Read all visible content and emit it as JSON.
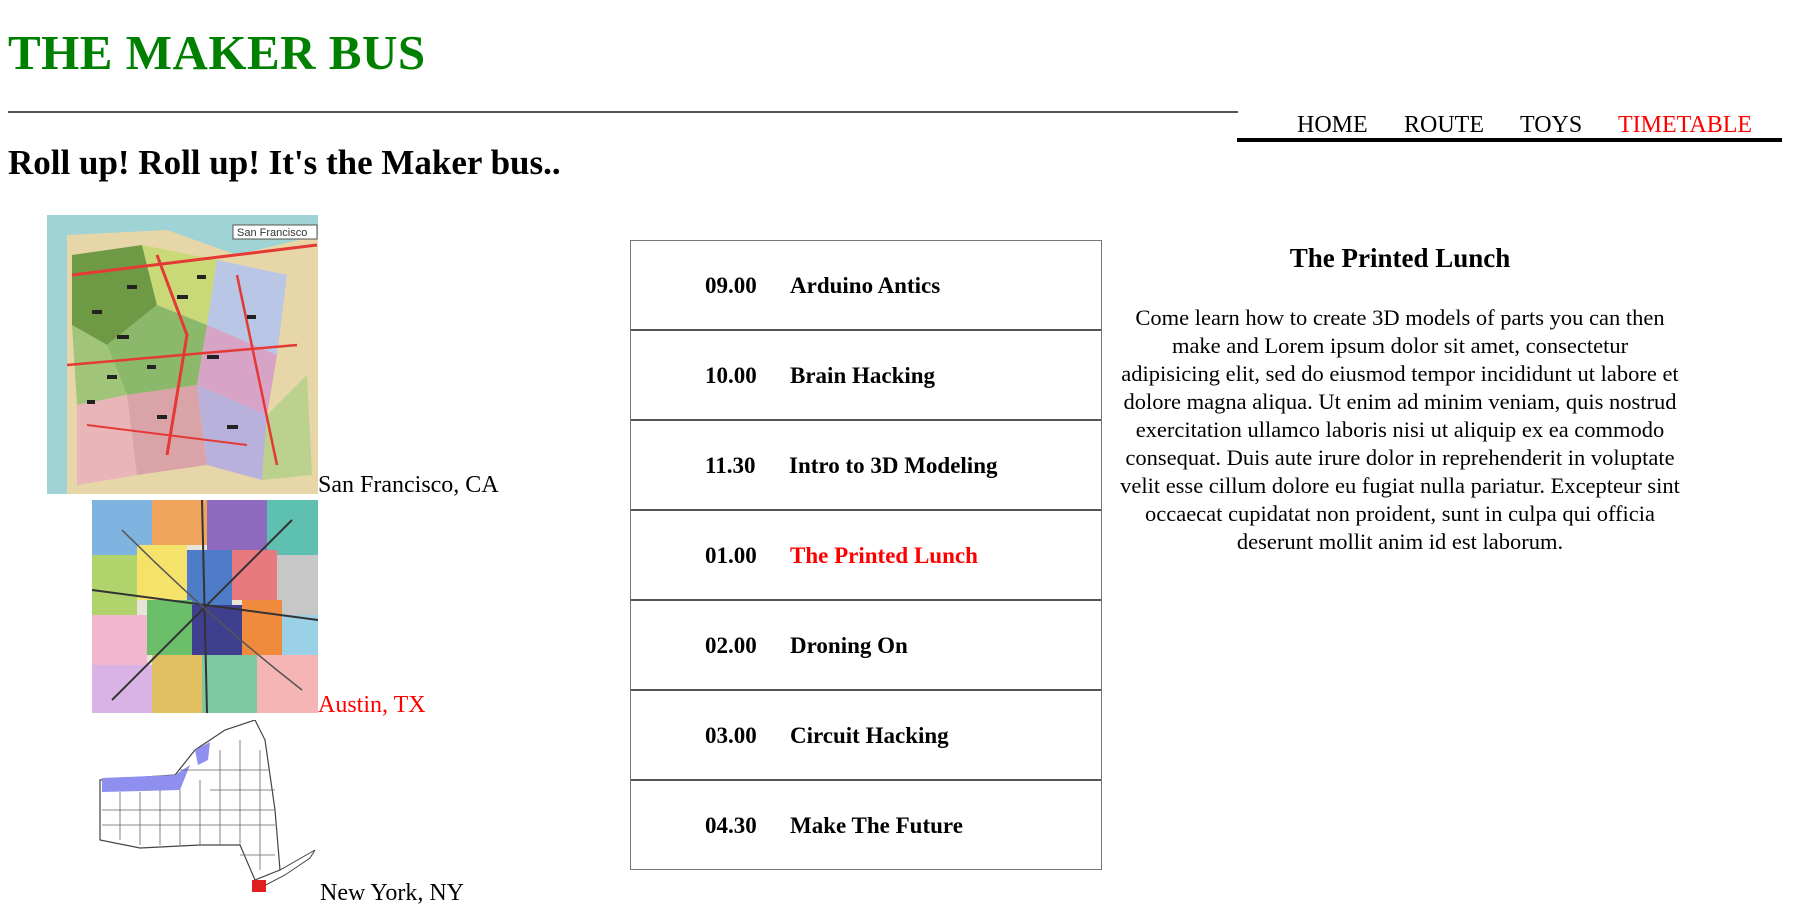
{
  "site": {
    "title": "THE MAKER BUS",
    "tagline": "Roll up! Roll up! It's the Maker bus.."
  },
  "nav": {
    "items": [
      {
        "label": "HOME",
        "active": false
      },
      {
        "label": "ROUTE",
        "active": false
      },
      {
        "label": "TOYS",
        "active": false
      },
      {
        "label": "TIMETABLE",
        "active": true
      }
    ]
  },
  "locations": [
    {
      "name": "San Francisco, CA",
      "active": false,
      "map_text": "San Francisco"
    },
    {
      "name": "Austin, TX",
      "active": true
    },
    {
      "name": "New York, NY",
      "active": false
    }
  ],
  "schedule": [
    {
      "time": "09.00",
      "title": "Arduino Antics",
      "active": false
    },
    {
      "time": "10.00",
      "title": "Brain Hacking",
      "active": false
    },
    {
      "time": "11.30",
      "title": "Intro to 3D Modeling",
      "active": false
    },
    {
      "time": "01.00",
      "title": "The Printed Lunch",
      "active": true
    },
    {
      "time": "02.00",
      "title": "Droning On",
      "active": false
    },
    {
      "time": "03.00",
      "title": "Circuit Hacking",
      "active": false
    },
    {
      "time": "04.30",
      "title": "Make The Future",
      "active": false
    }
  ],
  "detail": {
    "heading": "The Printed Lunch",
    "body": "Come learn how to create 3D models of parts you can then make and Lorem ipsum dolor sit amet, consectetur adipisicing elit, sed do eiusmod tempor incididunt ut labore et dolore magna aliqua. Ut enim ad minim veniam, quis nostrud exercitation ullamco laboris nisi ut aliquip ex ea commodo consequat. Duis aute irure dolor in reprehenderit in voluptate velit esse cillum dolore eu fugiat nulla pariatur. Excepteur sint occaecat cupidatat non proident, sunt in culpa qui officia deserunt mollit anim id est laborum."
  },
  "colors": {
    "brand": "#008000",
    "active": "#ff0000",
    "text": "#000000"
  }
}
